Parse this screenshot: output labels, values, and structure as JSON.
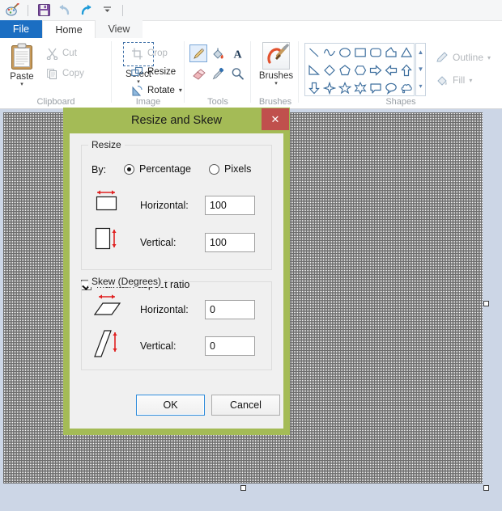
{
  "app": {
    "name": "Paint",
    "quick_access": [
      {
        "name": "paint-logo-icon",
        "label": "Paint"
      },
      {
        "name": "save-icon",
        "label": "Save"
      },
      {
        "name": "undo-icon",
        "label": "Undo"
      },
      {
        "name": "redo-icon",
        "label": "Redo"
      },
      {
        "name": "customize-quick-access-icon",
        "label": "Customize Quick Access Toolbar"
      }
    ]
  },
  "tabs": [
    {
      "label": "File",
      "selected": false,
      "name": "tab-file"
    },
    {
      "label": "Home",
      "selected": true,
      "name": "tab-home"
    },
    {
      "label": "View",
      "selected": false,
      "name": "tab-view"
    }
  ],
  "ribbon": {
    "groups": [
      {
        "label": "Clipboard",
        "paste": {
          "label": "Paste",
          "caret": "▾"
        },
        "items": [
          {
            "label": "Cut",
            "icon": "scissors-icon",
            "disabled": true
          },
          {
            "label": "Copy",
            "icon": "copy-icon",
            "disabled": true
          }
        ]
      },
      {
        "label": "Image",
        "select": {
          "label": "Select",
          "caret": "▾"
        },
        "items": [
          {
            "label": "Crop",
            "icon": "crop-icon",
            "disabled": true
          },
          {
            "label": "Resize",
            "icon": "resize-icon",
            "disabled": false
          },
          {
            "label": "Rotate",
            "icon": "rotate-icon",
            "disabled": false,
            "caret": "▾"
          }
        ]
      },
      {
        "label": "Tools",
        "tools": [
          {
            "name": "pencil-tool-icon",
            "selected": true
          },
          {
            "name": "fill-with-color-tool-icon",
            "selected": false
          },
          {
            "name": "text-tool-icon",
            "selected": false
          },
          {
            "name": "eraser-tool-icon",
            "selected": false
          },
          {
            "name": "color-picker-tool-icon",
            "selected": false
          },
          {
            "name": "magnifier-tool-icon",
            "selected": false
          }
        ]
      },
      {
        "label": "Brushes",
        "brushes": {
          "label": "Brushes",
          "caret": "▾"
        }
      },
      {
        "label": "Shapes",
        "shapes": [
          "line-shape-icon",
          "curve-shape-icon",
          "oval-shape-icon",
          "rectangle-shape-icon",
          "rounded-rectangle-shape-icon",
          "polygon-shape-icon",
          "triangle-shape-icon",
          "right-triangle-shape-icon",
          "diamond-shape-icon",
          "pentagon-shape-icon",
          "hexagon-shape-icon",
          "right-arrow-shape-icon",
          "left-arrow-shape-icon",
          "up-arrow-shape-icon",
          "down-arrow-shape-icon",
          "four-point-star-shape-icon",
          "five-point-star-shape-icon",
          "six-point-star-shape-icon",
          "rounded-callout-shape-icon",
          "oval-callout-shape-icon",
          "cloud-callout-shape-icon"
        ],
        "scroll": {
          "up": "▲",
          "down": "▼",
          "more": "▾"
        },
        "outline": {
          "label": "Outline",
          "caret": "▾",
          "disabled": true
        },
        "fill": {
          "label": "Fill",
          "caret": "▾",
          "disabled": true
        }
      }
    ]
  },
  "dialog": {
    "title": "Resize and Skew",
    "close_label": "✕",
    "border_color": "#a4bb56",
    "close_color": "#c0504d",
    "resize": {
      "group_title": "Resize",
      "by_label": "By:",
      "options": [
        {
          "label": "Percentage",
          "selected": true
        },
        {
          "label": "Pixels",
          "selected": false
        }
      ],
      "horizontal_label": "Horizontal:",
      "horizontal_value": "100",
      "vertical_label": "Vertical:",
      "vertical_value": "100",
      "maintain_aspect_ratio_label": "Maintain aspect ratio",
      "maintain_aspect_ratio_checked": true
    },
    "skew": {
      "group_title": "Skew (Degrees)",
      "horizontal_label": "Horizontal:",
      "horizontal_value": "0",
      "vertical_label": "Vertical:",
      "vertical_value": "0"
    },
    "buttons": {
      "ok": "OK",
      "cancel": "Cancel"
    }
  },
  "canvas": {
    "grid_visible": true,
    "background": "#ffffff"
  }
}
